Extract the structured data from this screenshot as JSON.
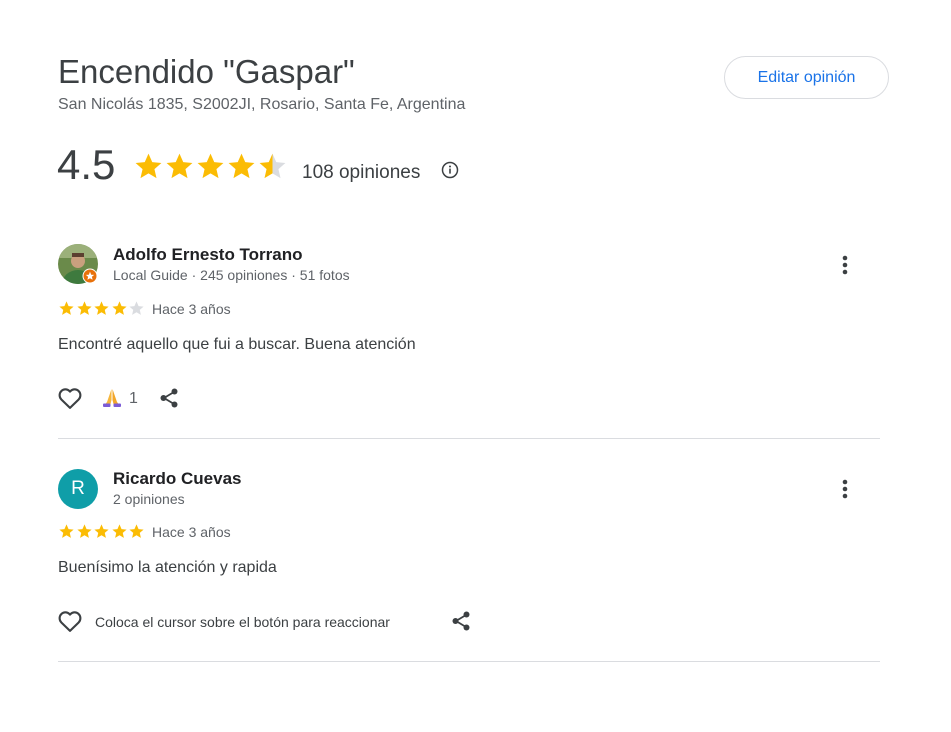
{
  "place": {
    "name": "Encendido \"Gaspar\"",
    "address": "San Nicolás 1835, S2002JI, Rosario, Santa Fe, Argentina",
    "edit_label": "Editar opinión",
    "rating": "4.5",
    "rating_value": 4.5,
    "reviews_count": "108 opiniones"
  },
  "colors": {
    "star": "#fbbc04",
    "star_empty": "#dadce0",
    "accent": "#1a73e8",
    "avatar_bg": "#0f9ea8",
    "guide_badge": "#e8710a"
  },
  "reviews": [
    {
      "name": "Adolfo Ernesto Torrano",
      "meta": "Local Guide · 245 opiniones · 51 fotos",
      "stars": 4,
      "time": "Hace 3 años",
      "text": "Encontré aquello que fui a buscar. Buena atención",
      "reaction_count": "1",
      "icons": [
        "heart-icon",
        "pray-reaction-icon",
        "share-icon",
        "more-vert-icon"
      ]
    },
    {
      "name": "Ricardo Cuevas",
      "initial": "R",
      "meta": "2 opiniones",
      "stars": 5,
      "time": "Hace 3 años",
      "text": "Buenísimo la atención y rapida",
      "react_hint": "Coloca el cursor sobre el botón para reaccionar",
      "icons": [
        "heart-icon",
        "share-icon",
        "more-vert-icon"
      ]
    }
  ]
}
